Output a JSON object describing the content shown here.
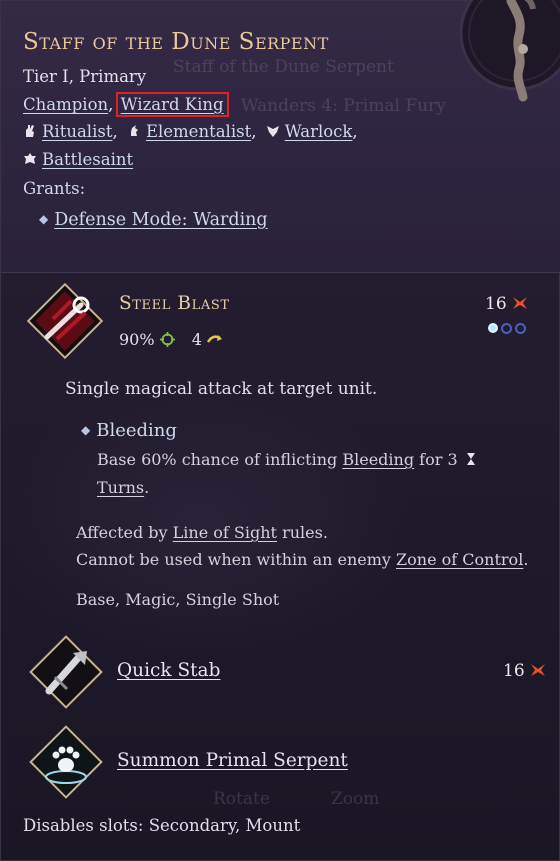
{
  "item": {
    "title": "Staff of the Dune Serpent",
    "subtitle": "Tier I, Primary",
    "affinities": [
      "Champion",
      "Wizard King"
    ],
    "classes": [
      "Ritualist",
      "Elementalist",
      "Warlock",
      "Battlesaint"
    ],
    "grants_label": "Grants:",
    "grant": "Defense Mode: Warding"
  },
  "ghost_text": {
    "line1": "Staff of the Dune Serpent",
    "line2": "Wanders 4: Primal Fury",
    "rotate": "Rotate",
    "zoom": "Zoom"
  },
  "abilities": [
    {
      "name": "Steel Blast",
      "cost": "16",
      "accuracy": "90%",
      "range": "4",
      "description": "Single magical attack at target unit.",
      "effect_name": "Bleeding",
      "effect_text_1": "Base 60% chance of inflicting",
      "effect_link": "Bleeding",
      "effect_text_2": "for 3",
      "effect_link_2": "Turns",
      "effect_text_3": ".",
      "affected_by": "Affected by",
      "los_link": "Line of Sight",
      "rules": "rules.",
      "cannot_text": "Cannot be used when within an enemy",
      "zoc_link": "Zone of Control",
      "period": ".",
      "tags": "Base, Magic, Single Shot"
    },
    {
      "name": "Quick Stab",
      "cost": "16"
    },
    {
      "name": "Summon Primal Serpent"
    }
  ],
  "disables": "Disables slots: Secondary, Mount",
  "colors": {
    "title": "#e9c99c",
    "link": "#cfd8ee",
    "highlight_box": "#e01f26",
    "cost_icon": "#e8502e"
  }
}
